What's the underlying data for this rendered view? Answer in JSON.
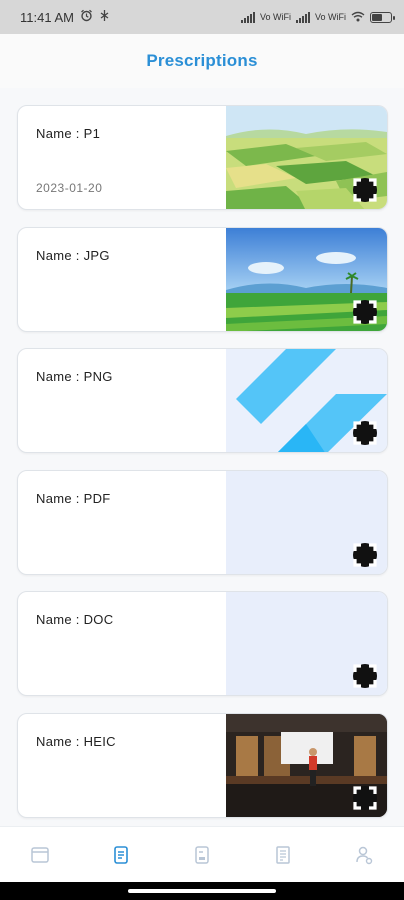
{
  "status_bar": {
    "time": "11:41 AM",
    "left_icons": [
      "alarm-icon",
      "notification-icon"
    ],
    "net1": "Vo WiFi",
    "net2": "Vo WiFi",
    "battery_level": 0.6
  },
  "header": {
    "title": "Prescriptions"
  },
  "colors": {
    "accent": "#2b8fd6",
    "thumb_placeholder": "#e8eefb",
    "expand_button": "#111111"
  },
  "prescriptions": [
    {
      "name": "Name : P1",
      "date": "2023-01-20",
      "thumbnail": "farm-fields-image"
    },
    {
      "name": "Name : JPG",
      "date": "",
      "thumbnail": "green-landscape-image"
    },
    {
      "name": "Name : PNG",
      "date": "",
      "thumbnail": "flutter-logo-image"
    },
    {
      "name": "Name : PDF",
      "date": "",
      "thumbnail": "blank-placeholder"
    },
    {
      "name": "Name : DOC",
      "date": "",
      "thumbnail": "blank-placeholder"
    },
    {
      "name": "Name : HEIC",
      "date": "",
      "thumbnail": "stage-photo-image"
    }
  ],
  "bottom_nav": {
    "items": [
      "dashboard-icon",
      "prescriptions-icon",
      "notebook-icon",
      "document-icon",
      "profile-icon"
    ],
    "active": "prescriptions-icon"
  }
}
